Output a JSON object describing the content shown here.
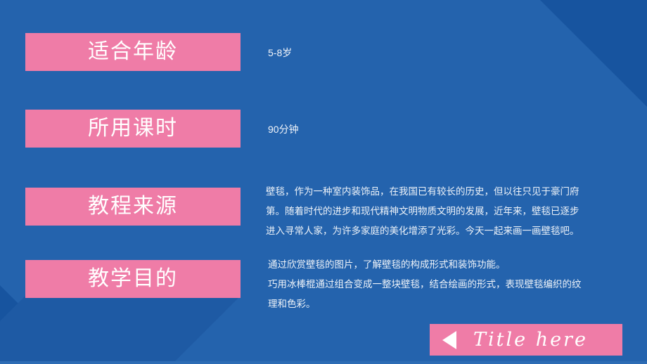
{
  "slide": {
    "background_color": "#2463ad",
    "accent_color": "#ef7ca7",
    "shadow_color": "#17549f",
    "text_color": "#ffffff"
  },
  "rows": [
    {
      "label": "适合年龄",
      "value": "5-8岁"
    },
    {
      "label": "所用课时",
      "value": "90分钟"
    },
    {
      "label": "教程来源",
      "paragraph_lines": [
        "壁毯，作为一种室内装饰品，在我国已有较长的历史，但以往只见于豪门府",
        "第。随着时代的进步和现代精神文明物质文明的发展，近年来，壁毯已逐步",
        "进入寻常人家，为许多家庭的美化增添了光彩。今天一起来画一画壁毯吧。"
      ]
    },
    {
      "label": "教学目的",
      "paragraph_lines": [
        "通过欣赏壁毯的图片，了解壁毯的构成形式和装饰功能。",
        "巧用冰棒棍通过组合变成一整块壁毯，结合绘画的形式，表现壁毯编织的纹",
        "理和色彩。"
      ]
    }
  ],
  "footer_button": {
    "label": "Title here",
    "icon": "triangle-left-icon"
  }
}
